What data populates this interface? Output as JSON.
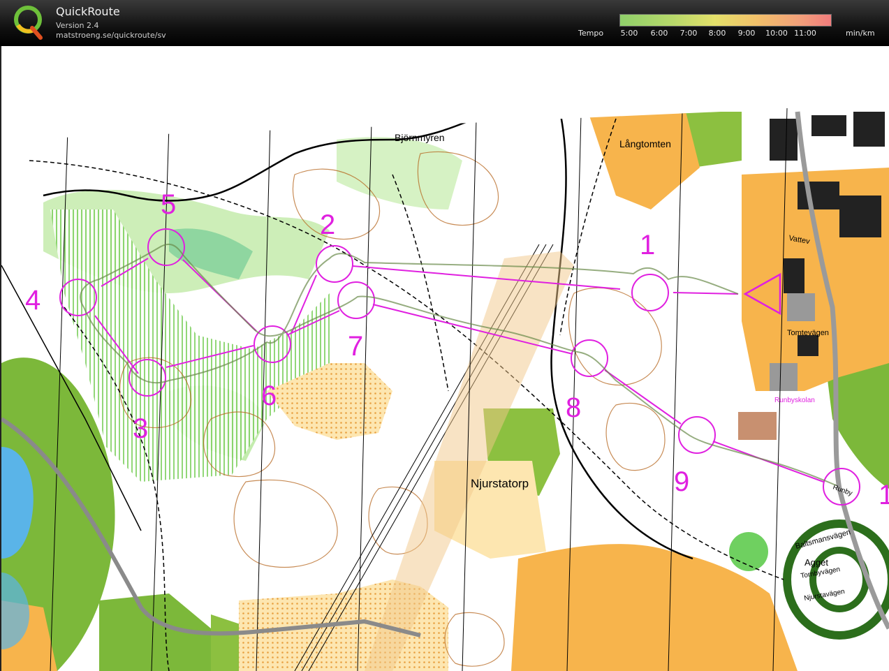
{
  "app": {
    "title": "QuickRoute",
    "version": "Version 2.4",
    "url": "matstroeng.se/quickroute/sv"
  },
  "legend": {
    "label": "Tempo",
    "ticks": [
      "5:00",
      "6:00",
      "7:00",
      "8:00",
      "9:00",
      "10:00",
      "11:00"
    ],
    "unit": "min/km"
  },
  "map": {
    "place_names": [
      "Björnmyren",
      "Långtomten",
      "Njurstatorp",
      "Vattev",
      "Tomtevägen",
      "Runbyskolan",
      "Baltsmansvägen",
      "Agget",
      "Tornbyvägen",
      "Njurstavägen",
      "Runby"
    ],
    "controls": [
      "1",
      "2",
      "3",
      "4",
      "5",
      "6",
      "7",
      "8",
      "9",
      "1"
    ],
    "colors": {
      "course": "#e020e0",
      "white_forest": "#ffffff",
      "open_land": "#f7b04a",
      "rough_open": "#fce0a0",
      "dense_green": "#74c044",
      "light_green": "#c8ecb0",
      "marsh": "#3ab0a0",
      "contour": "#b5651d",
      "water": "#5ab4e8",
      "built": "#8a8a8a",
      "road": "#a0a0a0"
    }
  }
}
